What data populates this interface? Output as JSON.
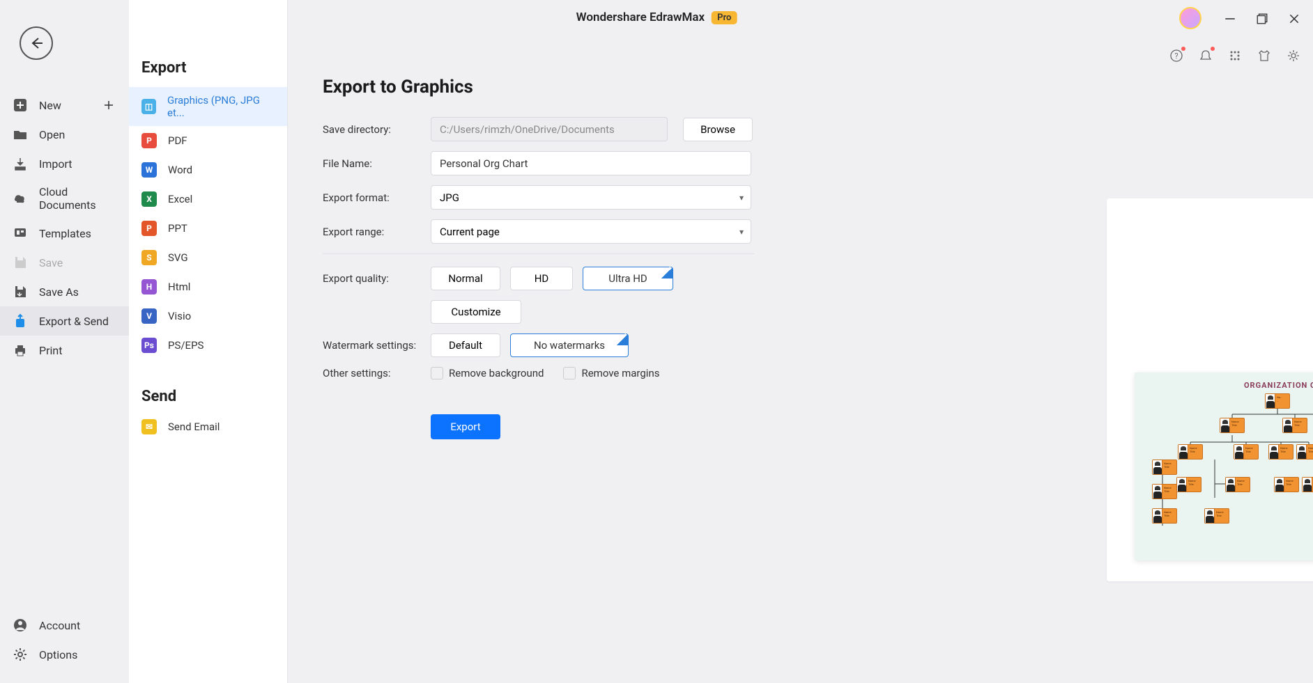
{
  "app": {
    "title": "Wondershare EdrawMax",
    "badge": "Pro"
  },
  "nav": {
    "items": [
      {
        "label": "New",
        "icon": "plus",
        "hasPlus": true
      },
      {
        "label": "Open",
        "icon": "folder"
      },
      {
        "label": "Import",
        "icon": "import"
      },
      {
        "label": "Cloud Documents",
        "icon": "cloud"
      },
      {
        "label": "Templates",
        "icon": "templates"
      },
      {
        "label": "Save",
        "icon": "save",
        "disabled": true
      },
      {
        "label": "Save As",
        "icon": "saveas"
      },
      {
        "label": "Export & Send",
        "icon": "export",
        "selected": true
      },
      {
        "label": "Print",
        "icon": "print"
      }
    ],
    "bottom": [
      {
        "label": "Account",
        "icon": "account"
      },
      {
        "label": "Options",
        "icon": "gear"
      }
    ]
  },
  "mid": {
    "header": "Export",
    "exportItems": [
      {
        "label": "Graphics (PNG, JPG et...",
        "color": "#49b0e8",
        "active": true
      },
      {
        "label": "PDF",
        "color": "#e74c3c"
      },
      {
        "label": "Word",
        "color": "#2b72d9"
      },
      {
        "label": "Excel",
        "color": "#1e8b4d"
      },
      {
        "label": "PPT",
        "color": "#e3562a"
      },
      {
        "label": "SVG",
        "color": "#f0a724"
      },
      {
        "label": "Html",
        "color": "#9556d4"
      },
      {
        "label": "Visio",
        "color": "#3864c4"
      },
      {
        "label": "PS/EPS",
        "color": "#6a4dd0"
      }
    ],
    "sendHeader": "Send",
    "sendItems": [
      {
        "label": "Send Email",
        "color": "#f0c020"
      }
    ]
  },
  "main": {
    "title": "Export to Graphics",
    "labels": {
      "saveDir": "Save directory:",
      "fileName": "File Name:",
      "format": "Export format:",
      "range": "Export range:",
      "quality": "Export quality:",
      "watermark": "Watermark settings:",
      "other": "Other settings:"
    },
    "values": {
      "saveDir": "C:/Users/rimzh/OneDrive/Documents",
      "fileName": "Personal Org Chart",
      "format": "JPG",
      "range": "Current page"
    },
    "buttons": {
      "browse": "Browse",
      "normal": "Normal",
      "hd": "HD",
      "ultrahd": "Ultra HD",
      "customize": "Customize",
      "default": "Default",
      "noWatermark": "No watermarks",
      "removeBg": "Remove background",
      "removeMargins": "Remove margins",
      "export": "Export"
    }
  },
  "preview": {
    "title": "ORGANIZATION CHART",
    "nodeName": "Name",
    "nodeTitle": "Title"
  }
}
